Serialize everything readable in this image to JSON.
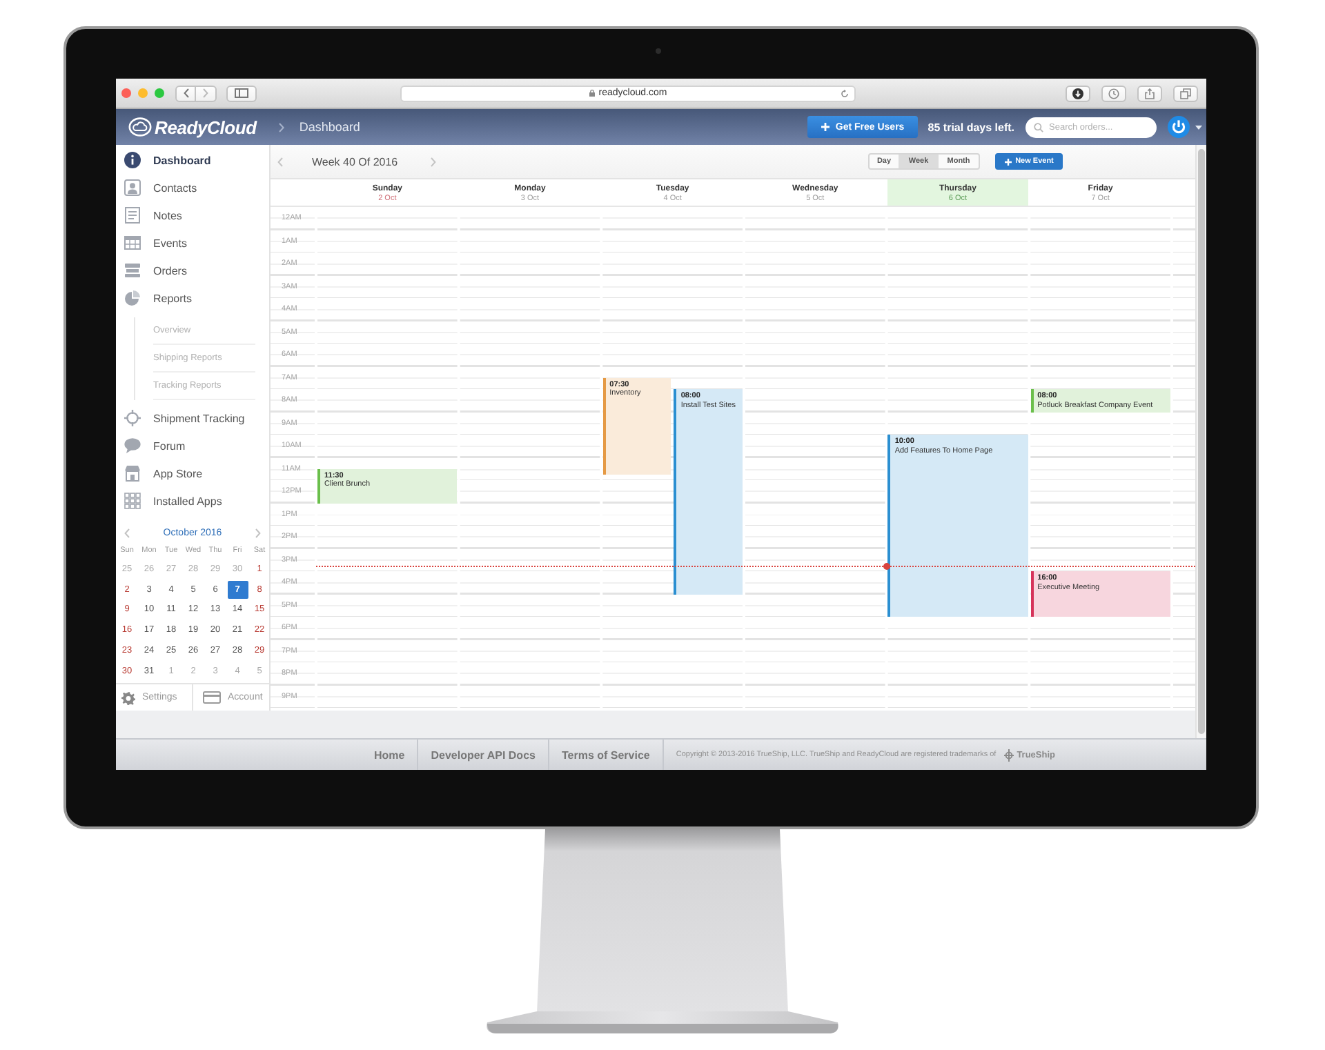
{
  "browser": {
    "url": "readycloud.com"
  },
  "header": {
    "logo": "ReadyCloud",
    "breadcrumb": "Dashboard",
    "invite_button": "Get Free Users",
    "trial_notice": "85 trial days left.",
    "search": {
      "placeholder": "Search orders..."
    }
  },
  "sidebar": {
    "items": [
      {
        "label": "Dashboard",
        "selected": true
      },
      {
        "label": "Contacts",
        "selected": false
      },
      {
        "label": "Notes",
        "selected": false
      },
      {
        "label": "Events",
        "selected": false
      },
      {
        "label": "Orders",
        "selected": false
      },
      {
        "label": "Reports",
        "selected": false,
        "children": [
          {
            "label": "Overview"
          },
          {
            "label": "Shipping Reports"
          },
          {
            "label": "Tracking Reports"
          }
        ]
      },
      {
        "label": "Shipment Tracking",
        "selected": false
      },
      {
        "label": "Forum",
        "selected": false
      },
      {
        "label": "App Store",
        "selected": false
      },
      {
        "label": "Installed Apps",
        "selected": false
      }
    ],
    "mini_calendar": {
      "title": "October 2016",
      "weekdays": [
        "Sun",
        "Mon",
        "Tue",
        "Wed",
        "Thu",
        "Fri",
        "Sat"
      ],
      "weeks": [
        [
          {
            "day": "25",
            "other_month": true,
            "selected": false
          },
          {
            "day": "26",
            "other_month": true,
            "selected": false
          },
          {
            "day": "27",
            "other_month": true,
            "selected": false
          },
          {
            "day": "28",
            "other_month": true,
            "selected": false
          },
          {
            "day": "29",
            "other_month": true,
            "selected": false
          },
          {
            "day": "30",
            "other_month": true,
            "selected": false
          },
          {
            "day": "1",
            "other_month": false,
            "selected": false
          }
        ],
        [
          {
            "day": "2",
            "other_month": false,
            "selected": false
          },
          {
            "day": "3",
            "other_month": false,
            "selected": false
          },
          {
            "day": "4",
            "other_month": false,
            "selected": false
          },
          {
            "day": "5",
            "other_month": false,
            "selected": false
          },
          {
            "day": "6",
            "other_month": false,
            "selected": false
          },
          {
            "day": "7",
            "other_month": false,
            "selected": true
          },
          {
            "day": "8",
            "other_month": false,
            "selected": false
          }
        ],
        [
          {
            "day": "9",
            "other_month": false,
            "selected": false
          },
          {
            "day": "10",
            "other_month": false,
            "selected": false
          },
          {
            "day": "11",
            "other_month": false,
            "selected": false
          },
          {
            "day": "12",
            "other_month": false,
            "selected": false
          },
          {
            "day": "13",
            "other_month": false,
            "selected": false
          },
          {
            "day": "14",
            "other_month": false,
            "selected": false
          },
          {
            "day": "15",
            "other_month": false,
            "selected": false
          }
        ],
        [
          {
            "day": "16",
            "other_month": false,
            "selected": false
          },
          {
            "day": "17",
            "other_month": false,
            "selected": false
          },
          {
            "day": "18",
            "other_month": false,
            "selected": false
          },
          {
            "day": "19",
            "other_month": false,
            "selected": false
          },
          {
            "day": "20",
            "other_month": false,
            "selected": false
          },
          {
            "day": "21",
            "other_month": false,
            "selected": false
          },
          {
            "day": "22",
            "other_month": false,
            "selected": false
          }
        ],
        [
          {
            "day": "23",
            "other_month": false,
            "selected": false
          },
          {
            "day": "24",
            "other_month": false,
            "selected": false
          },
          {
            "day": "25",
            "other_month": false,
            "selected": false
          },
          {
            "day": "26",
            "other_month": false,
            "selected": false
          },
          {
            "day": "27",
            "other_month": false,
            "selected": false
          },
          {
            "day": "28",
            "other_month": false,
            "selected": false
          },
          {
            "day": "29",
            "other_month": false,
            "selected": false
          }
        ],
        [
          {
            "day": "30",
            "other_month": false,
            "selected": false
          },
          {
            "day": "31",
            "other_month": false,
            "selected": false
          },
          {
            "day": "1",
            "other_month": true,
            "selected": false
          },
          {
            "day": "2",
            "other_month": true,
            "selected": false
          },
          {
            "day": "3",
            "other_month": true,
            "selected": false
          },
          {
            "day": "4",
            "other_month": true,
            "selected": false
          },
          {
            "day": "5",
            "other_month": true,
            "selected": false
          }
        ]
      ]
    },
    "bottom_links": [
      {
        "label": "Settings"
      },
      {
        "label": "Account"
      }
    ]
  },
  "calendar": {
    "title": "Week 40 Of 2016",
    "views": [
      {
        "label": "Day",
        "selected": false
      },
      {
        "label": "Week",
        "selected": true
      },
      {
        "label": "Month",
        "selected": false
      }
    ],
    "new_event_button": "New Event",
    "hours": [
      {
        "label": "12AM",
        "current": false
      },
      {
        "label": "1AM",
        "current": false
      },
      {
        "label": "2AM",
        "current": false
      },
      {
        "label": "3AM",
        "current": false
      },
      {
        "label": "4AM",
        "current": false
      },
      {
        "label": "5AM",
        "current": false
      },
      {
        "label": "6AM",
        "current": false
      },
      {
        "label": "7AM",
        "current": false
      },
      {
        "label": "8AM",
        "current": false
      },
      {
        "label": "9AM",
        "current": false
      },
      {
        "label": "10AM",
        "current": false
      },
      {
        "label": "11AM",
        "current": false
      },
      {
        "label": "12PM",
        "current": false
      },
      {
        "label": "1PM",
        "current": false
      },
      {
        "label": "2PM",
        "current": false
      },
      {
        "label": "3PM",
        "current": true
      },
      {
        "label": "4PM",
        "current": false
      },
      {
        "label": "5PM",
        "current": false
      },
      {
        "label": "6PM",
        "current": false
      },
      {
        "label": "7PM",
        "current": false
      },
      {
        "label": "8PM",
        "current": false
      },
      {
        "label": "9PM",
        "current": false
      }
    ],
    "days": [
      {
        "name": "Sunday",
        "date": "2 Oct",
        "today": false,
        "weekend": true,
        "events": [
          {
            "time": "11:30",
            "title": "Client Brunch",
            "color": "#6abf4b"
          }
        ]
      },
      {
        "name": "Monday",
        "date": "3 Oct",
        "today": false,
        "weekend": false
      },
      {
        "name": "Tuesday",
        "date": "4 Oct",
        "today": false,
        "weekend": false,
        "events": [
          {
            "time": "07:30",
            "title": "Inventory",
            "color": "#e59a45"
          },
          {
            "time": "08:00",
            "title": "Install Test Sites",
            "color": "#2b8fd1"
          }
        ]
      },
      {
        "name": "Wednesday",
        "date": "5 Oct",
        "today": false,
        "weekend": false
      },
      {
        "name": "Thursday",
        "date": "6 Oct",
        "today": true,
        "weekend": false,
        "events": [
          {
            "time": "10:00",
            "title": "Add Features To Home Page",
            "color": "#2b8fd1"
          }
        ]
      },
      {
        "name": "Friday",
        "date": "7 Oct",
        "today": false,
        "weekend": false,
        "events": [
          {
            "time": "08:00",
            "title": "Potluck Breakfast Company Event",
            "color": "#6abf4b"
          },
          {
            "time": "16:00",
            "title": "Executive Meeting",
            "color": "#d6335a"
          }
        ]
      }
    ]
  },
  "footer": {
    "links": [
      "Home",
      "Developer API Docs",
      "Terms of Service"
    ],
    "copyright": "Copyright © 2013-2016 TrueShip, LLC. TrueShip and ReadyCloud are registered trademarks of",
    "brand": "TrueShip"
  }
}
